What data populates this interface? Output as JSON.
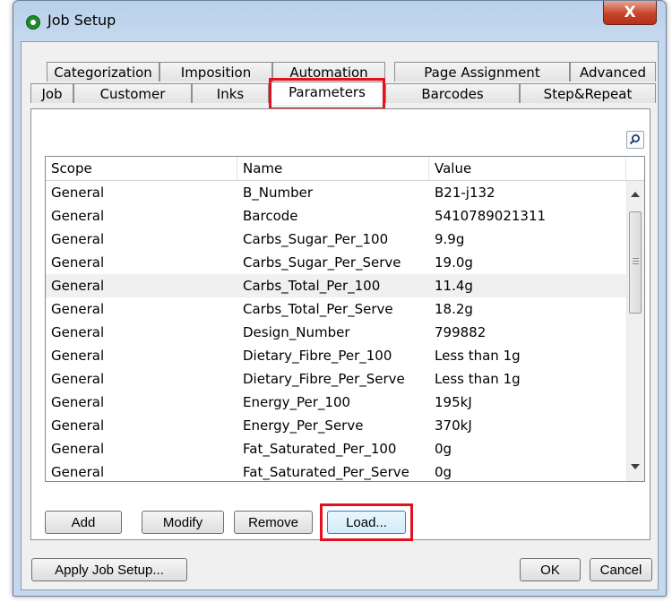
{
  "window": {
    "title": "Job Setup",
    "close_symbol": "X"
  },
  "tabs": {
    "row1": [
      "Categorization",
      "Imposition",
      "Automation",
      "Page Assignment",
      "Advanced"
    ],
    "row2": [
      "Job",
      "Customer",
      "Inks",
      "Parameters",
      "Barcodes",
      "Step&Repeat"
    ],
    "active": "Parameters"
  },
  "table": {
    "columns": [
      "Scope",
      "Name",
      "Value"
    ],
    "rows": [
      [
        "General",
        "B_Number",
        "B21-j132"
      ],
      [
        "General",
        "Barcode",
        "5410789021311"
      ],
      [
        "General",
        "Carbs_Sugar_Per_100",
        "9.9g"
      ],
      [
        "General",
        "Carbs_Sugar_Per_Serve",
        "19.0g"
      ],
      [
        "General",
        "Carbs_Total_Per_100",
        "11.4g"
      ],
      [
        "General",
        "Carbs_Total_Per_Serve",
        "18.2g"
      ],
      [
        "General",
        "Design_Number",
        "799882"
      ],
      [
        "General",
        "Dietary_Fibre_Per_100",
        "Less than 1g"
      ],
      [
        "General",
        "Dietary_Fibre_Per_Serve",
        "Less than 1g"
      ],
      [
        "General",
        "Energy_Per_100",
        "195kJ"
      ],
      [
        "General",
        "Energy_Per_Serve",
        "370kJ"
      ],
      [
        "General",
        "Fat_Saturated_Per_100",
        "0g"
      ],
      [
        "General",
        "Fat_Saturated_Per_Serve",
        "0g"
      ]
    ],
    "selected_row": 4
  },
  "panel_buttons": {
    "add": "Add",
    "modify": "Modify",
    "remove": "Remove",
    "load": "Load..."
  },
  "footer_buttons": {
    "apply": "Apply Job Setup...",
    "ok": "OK",
    "cancel": "Cancel"
  },
  "colors": {
    "highlight": "#e3101e",
    "title_bar": "#b9d1ea",
    "close_button": "#c7442a"
  },
  "icons": {
    "app": "app-icon",
    "search": "search-icon",
    "close": "close-icon"
  }
}
